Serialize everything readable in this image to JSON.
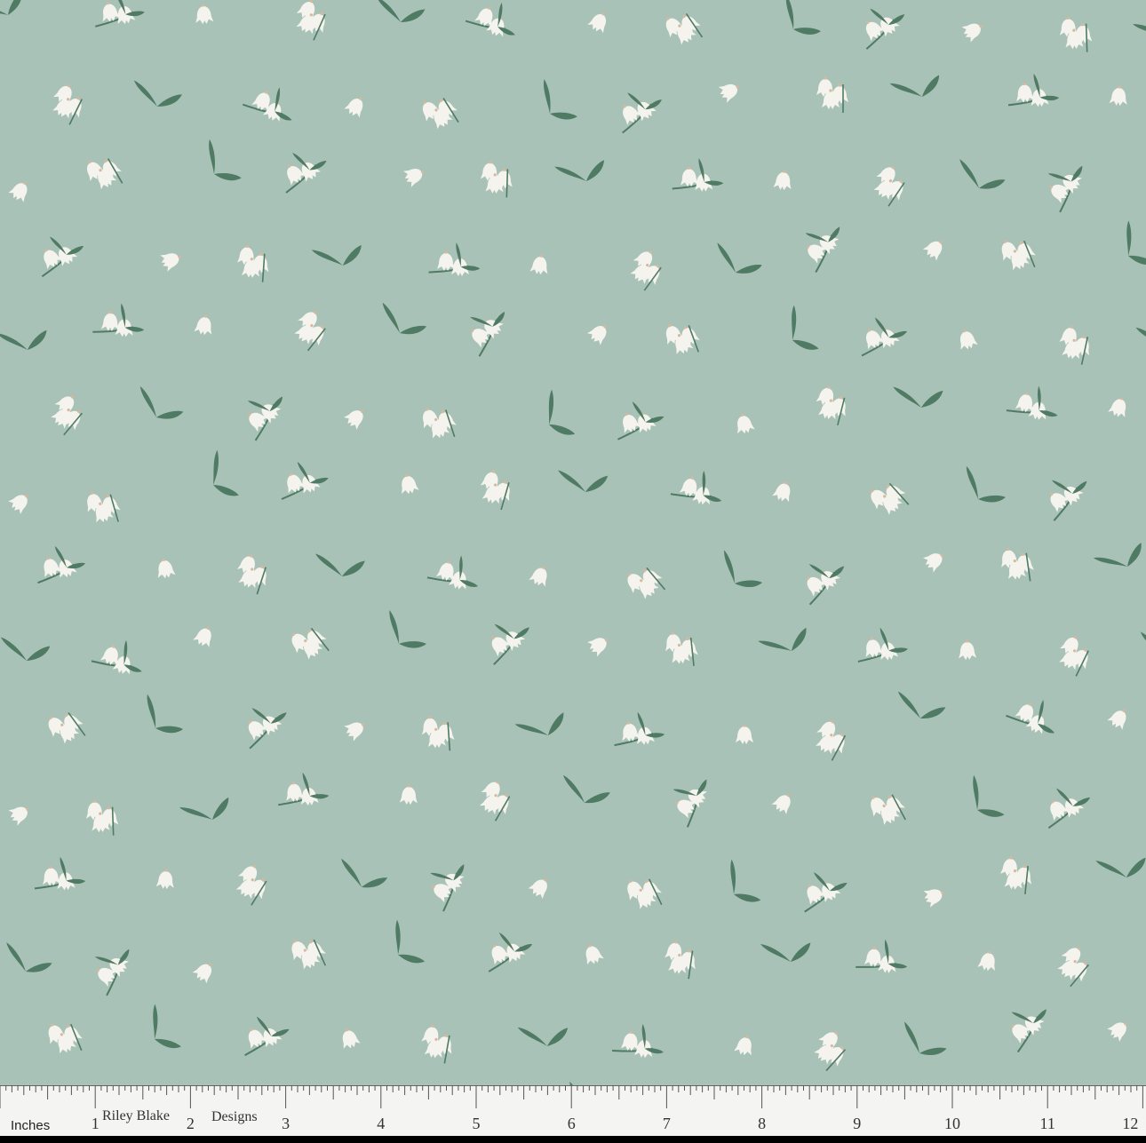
{
  "image": {
    "subject": "floral-fabric-swatch",
    "colors": {
      "background": "#a9c2b7",
      "leaf": "#4f7a63",
      "petal": "#f4f3ed",
      "ruler": "#f4f4f2",
      "ruler_text": "#333333"
    }
  },
  "ruler": {
    "unit_label": "Inches",
    "brand_part_1": "Riley Blake",
    "brand_part_2": "Designs",
    "numbers": [
      "1",
      "2",
      "3",
      "4",
      "5",
      "6",
      "7",
      "8",
      "9",
      "10",
      "11",
      "12"
    ]
  }
}
